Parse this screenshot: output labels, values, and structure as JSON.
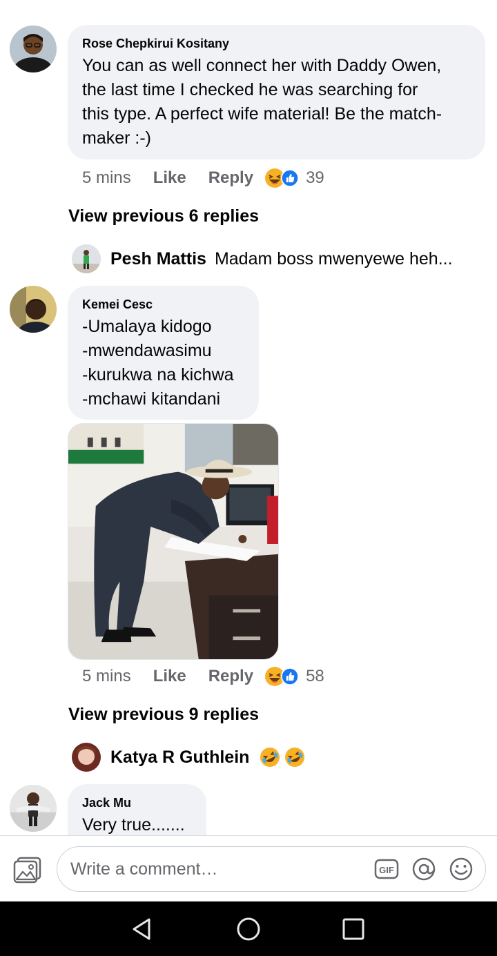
{
  "comments": [
    {
      "author": "Rose Chepkirui Kositany",
      "text": "You can as well connect her with Daddy Owen,\nthe last time I checked he was searching for\nthis type. A perfect wife material! Be the match-\nmaker :-)",
      "time": "5 mins",
      "like_label": "Like",
      "reply_label": "Reply",
      "reaction_icons": [
        "laugh-emoji",
        "like-emoji"
      ],
      "reaction_count": "39",
      "view_previous": "View previous 6 replies",
      "latest_reply": {
        "author": "Pesh Mattis",
        "text": "Madam boss mwenyewe heh..."
      }
    },
    {
      "author": "Kemei Cesc",
      "text": "-Umalaya kidogo\n-mwendawasimu\n-kurukwa na kichwa\n-mchawi kitandani",
      "has_photo": true,
      "time": "5 mins",
      "like_label": "Like",
      "reply_label": "Reply",
      "reaction_icons": [
        "laugh-emoji",
        "like-emoji"
      ],
      "reaction_count": "58",
      "view_previous": "View previous 9 replies",
      "latest_reply": {
        "author": "Katya R Guthlein",
        "text_emoji": [
          "rolling-laugh-emoji",
          "rolling-laugh-emoji"
        ]
      }
    },
    {
      "author": "Jack Mu",
      "text": "Very true......."
    }
  ],
  "composer": {
    "placeholder": "Write a comment…",
    "icons": [
      "photo-icon",
      "gif-icon",
      "mention-icon",
      "emoji-icon"
    ]
  },
  "nav": {
    "icons": [
      "back-icon",
      "home-icon",
      "recents-icon"
    ]
  },
  "colors": {
    "bubble": "#f0f2f5",
    "meta_text": "#65676b",
    "like_blue": "#1877f2",
    "laugh_yellow": "#f7b125"
  }
}
